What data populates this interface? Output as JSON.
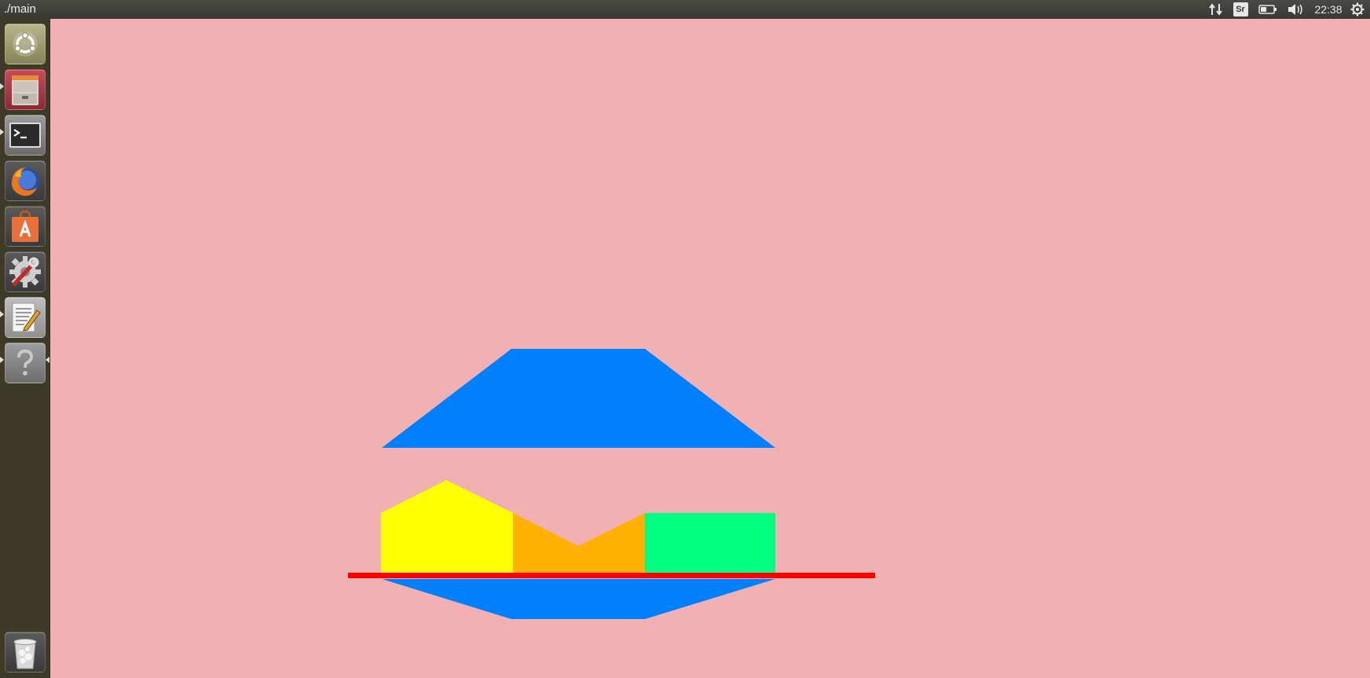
{
  "top_panel": {
    "window_title": "./main",
    "keyboard_indicator": "Sr",
    "clock": "22:38"
  },
  "launcher": {
    "items": [
      {
        "name": "dash-home",
        "icon": "ubuntu-logo-icon"
      },
      {
        "name": "files",
        "icon": "file-cabinet-icon"
      },
      {
        "name": "terminal",
        "icon": "terminal-icon"
      },
      {
        "name": "firefox",
        "icon": "firefox-icon"
      },
      {
        "name": "software-center",
        "icon": "shopping-bag-icon"
      },
      {
        "name": "system-settings",
        "icon": "gear-wrench-icon"
      },
      {
        "name": "text-editor",
        "icon": "notepad-pencil-icon"
      },
      {
        "name": "help",
        "icon": "question-mark-icon"
      },
      {
        "name": "trash",
        "icon": "trash-icon"
      }
    ]
  },
  "colors": {
    "workspace_background": "#f1b0b1",
    "launcher_background": "#3d3a27",
    "panel_background": "#3c3b37",
    "blue_shape": "#0080ff",
    "yellow_shape": "#ffff00",
    "orange_shape": "#ffb000",
    "green_shape": "#00ff80",
    "red_line": "#ff0000"
  }
}
